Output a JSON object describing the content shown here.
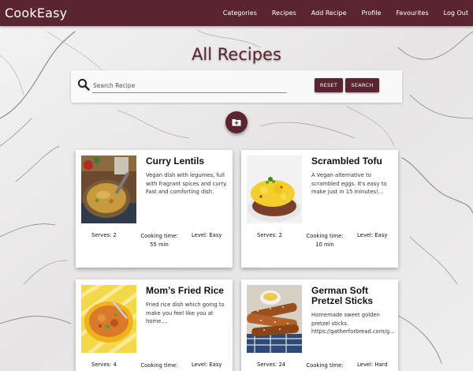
{
  "navbar": {
    "brand": "CookEasy",
    "links": [
      "Categories",
      "Recipes",
      "Add Recipe",
      "Profile",
      "Favourites",
      "Log Out"
    ]
  },
  "page_title": "All Recipes",
  "search": {
    "placeholder": "Search Recipe",
    "value": "",
    "reset_label": "RESET",
    "search_label": "SEARCH"
  },
  "icons": {
    "search": "search-icon",
    "add_folder": "folder-plus-icon"
  },
  "colors": {
    "brand": "#5a2530",
    "card_bg": "#ffffff"
  },
  "recipes": [
    {
      "title": "Curry Lentils",
      "description": "Vegan dish with legumes, full with fragrant spices and curry. Fast and comforting dish.",
      "serves_label": "Serves: 2",
      "time_label": "Cooking time:",
      "time_value": "55 min",
      "level_label": "Level: Easy",
      "image": "curry-lentils-photo"
    },
    {
      "title": "Scrambled Tofu",
      "description": "A Vegan alternative to scrambled eggs. It's easy to make just in 15 minutes!...",
      "serves_label": "Serves: 2",
      "time_label": "Cooking time:",
      "time_value": "10 min",
      "level_label": "Level: Easy",
      "image": "scrambled-tofu-photo"
    },
    {
      "title": "Mom’s Fried Rice",
      "description": "Fried rice dish which going to make you feel like you at home....",
      "serves_label": "Serves: 4",
      "time_label": "Cooking time:",
      "time_value": "",
      "level_label": "Level: Easy",
      "image": "fried-rice-photo"
    },
    {
      "title": "German Soft Pretzel Sticks",
      "description": "Homemade sweet golden pretzel sticks. https://gatherforbread.com/g...",
      "serves_label": "Serves: 24",
      "time_label": "Cooking time:",
      "time_value": "",
      "level_label": "Level: Hard",
      "image": "pretzel-sticks-photo"
    }
  ]
}
